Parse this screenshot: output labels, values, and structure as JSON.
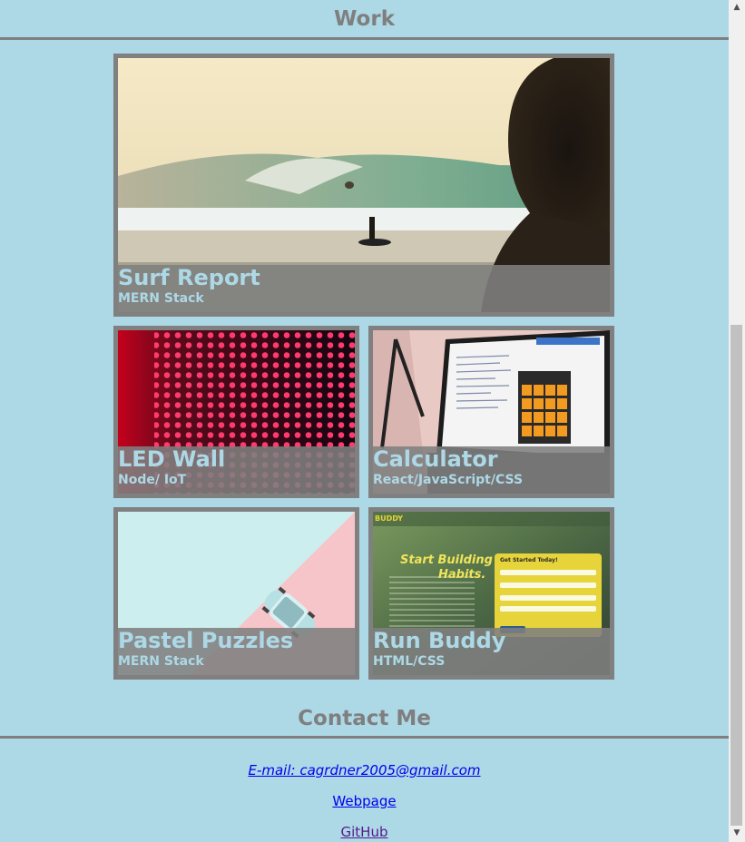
{
  "work": {
    "title": "Work"
  },
  "projects": [
    {
      "title": "Surf Report",
      "subtitle": "MERN Stack",
      "image": "surf-photo"
    },
    {
      "title": "LED Wall",
      "subtitle": "Node/ IoT",
      "image": "led-wall-photo"
    },
    {
      "title": "Calculator",
      "subtitle": "React/JavaScript/CSS",
      "image": "calculator-screenshot"
    },
    {
      "title": "Pastel Puzzles",
      "subtitle": "MERN Stack",
      "image": "pastel-car-photo"
    },
    {
      "title": "Run Buddy",
      "subtitle": "HTML/CSS",
      "image": "run-buddy-screenshot"
    }
  ],
  "run_buddy_art": {
    "logo": "BUDDY",
    "headline1": "Start Building",
    "headline2": "Habits.",
    "form_title": "Get Started Today!"
  },
  "contact": {
    "title": "Contact Me",
    "email": "E-mail: cagrdner2005@gmail.com",
    "webpage": "Webpage",
    "github": "GitHub"
  },
  "colors": {
    "background": "#add8e6",
    "accent_gray": "#808080",
    "link": "#0000ee",
    "visited_link": "#551a8b"
  }
}
